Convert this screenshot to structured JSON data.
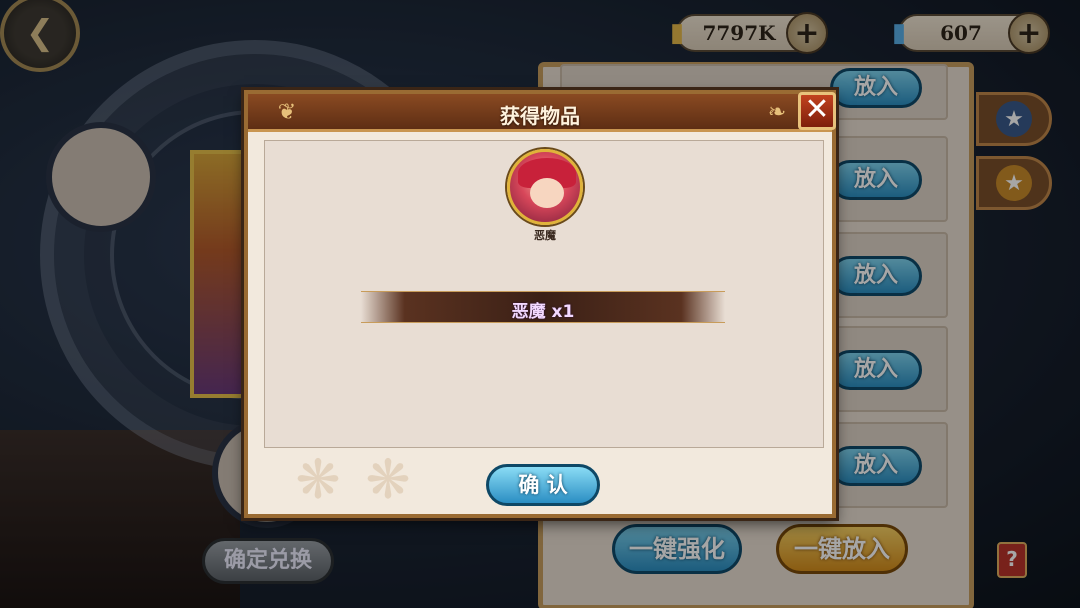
{
  "top_bar": {
    "gold": {
      "icon": "gold-coin-icon",
      "value": "7797K"
    },
    "gems": {
      "icon": "blue-gem-icon",
      "value": "607"
    }
  },
  "right_panel": {
    "put_in_label": "放入",
    "one_click_upgrade": "一键强化",
    "one_click_put": "一键放入",
    "help_icon": "help-book-icon",
    "tabs": [
      "blue-star-icon",
      "gold-star-icon"
    ]
  },
  "left_panel": {
    "confirm_exchange": "确定兑换"
  },
  "dialog": {
    "title": "获得物品",
    "item": {
      "name": "恶魔",
      "label": "恶魔 x1",
      "count": 1
    },
    "confirm": "确 认"
  },
  "colors": {
    "accent_blue": "#2c8fc2",
    "accent_gold": "#d48d1c",
    "header_brown": "#5e2e14"
  }
}
